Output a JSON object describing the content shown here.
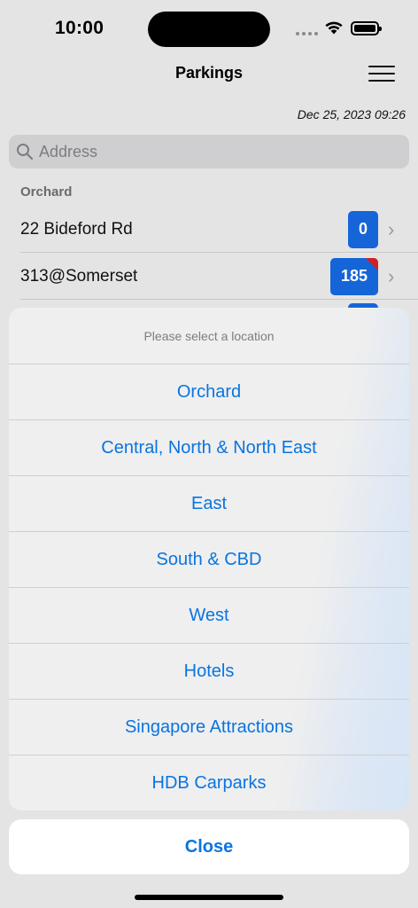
{
  "status_bar": {
    "time": "10:00"
  },
  "header": {
    "title": "Parkings",
    "datetime": "Dec 25, 2023 09:26"
  },
  "search": {
    "placeholder": "Address"
  },
  "section": {
    "title": "Orchard"
  },
  "rows": [
    {
      "label": "22 Bideford Rd",
      "count": "0"
    },
    {
      "label": "313@Somerset",
      "count": "185"
    }
  ],
  "action_sheet": {
    "message": "Please select a location",
    "options": [
      "Orchard",
      "Central, North & North East",
      "East",
      "South & CBD",
      "West",
      "Hotels",
      "Singapore Attractions",
      "HDB Carparks"
    ],
    "close_label": "Close"
  },
  "colors": {
    "accent": "#0a74e0",
    "badge": "#1565d8",
    "badge_corner": "#d42020"
  }
}
